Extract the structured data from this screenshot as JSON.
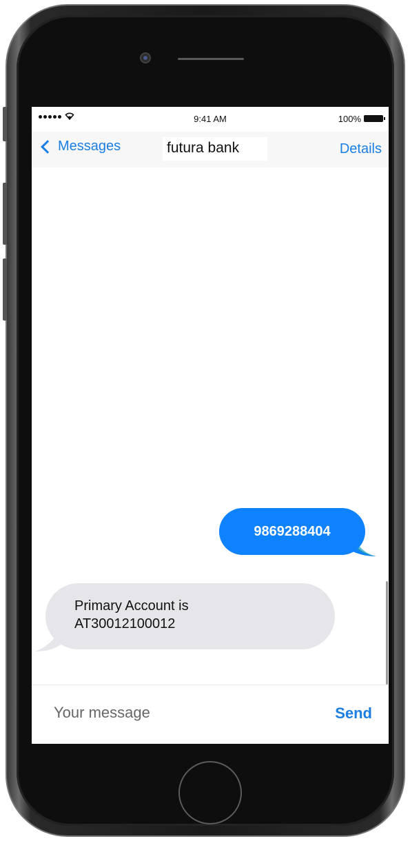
{
  "status_bar": {
    "time": "9:41 AM",
    "battery_percent": "100%",
    "wifi_icon": "὏6"
  },
  "nav": {
    "back_label": "Messages",
    "title": "futura bank",
    "details_label": "Details"
  },
  "messages": [
    {
      "direction": "sent",
      "text": "9869288404"
    },
    {
      "direction": "received",
      "line1": "Primary Account is",
      "line2": "AT30012100012"
    }
  ],
  "compose": {
    "placeholder": "Your message",
    "send_label": "Send"
  },
  "colors": {
    "accent": "#1a7ee3",
    "sent_bubble": "#0f82ff",
    "received_bubble": "#e6e6ea"
  }
}
